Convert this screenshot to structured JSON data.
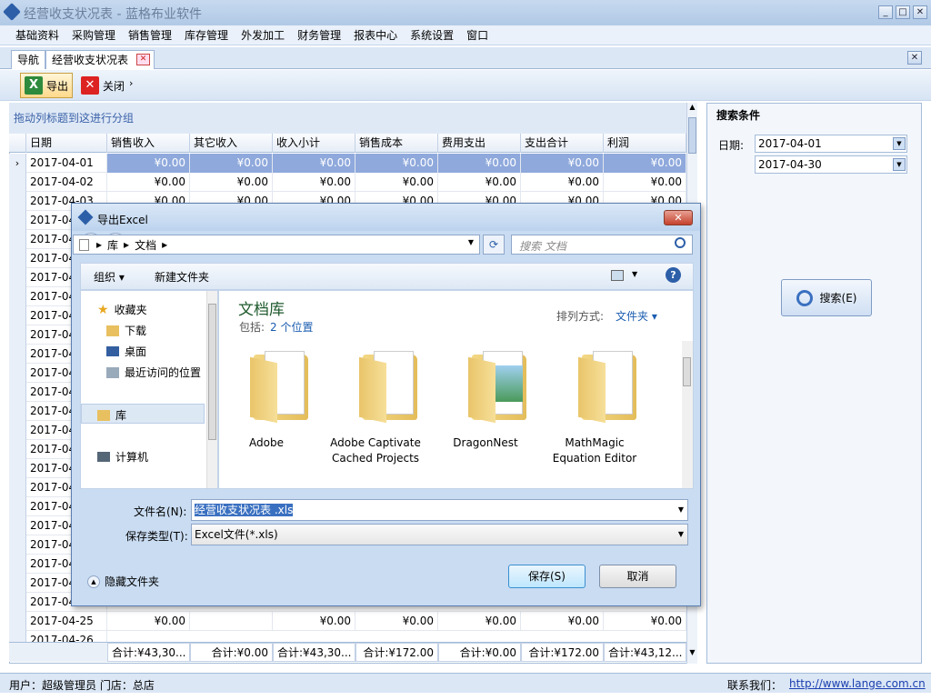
{
  "app": {
    "title": "经营收支状况表 - 蓝格布业软件"
  },
  "menu": [
    "基础资料",
    "采购管理",
    "销售管理",
    "库存管理",
    "外发加工",
    "财务管理",
    "报表中心",
    "系统设置",
    "窗口"
  ],
  "tabs": {
    "nav": "导航",
    "report": "经营收支状况表"
  },
  "toolbar": {
    "export": "导出",
    "close": "关闭"
  },
  "grid": {
    "group_hint": "拖动列标题到这进行分组",
    "columns": [
      "日期",
      "销售收入",
      "其它收入",
      "收入小计",
      "销售成本",
      "费用支出",
      "支出合计",
      "利润"
    ],
    "rows": [
      {
        "date": "2017-04-01",
        "v": [
          "¥0.00",
          "¥0.00",
          "¥0.00",
          "¥0.00",
          "¥0.00",
          "¥0.00",
          "¥0.00"
        ]
      },
      {
        "date": "2017-04-02",
        "v": [
          "¥0.00",
          "¥0.00",
          "¥0.00",
          "¥0.00",
          "¥0.00",
          "¥0.00",
          "¥0.00"
        ]
      },
      {
        "date": "2017-04-03",
        "v": [
          "¥0.00",
          "¥0.00",
          "¥0.00",
          "¥0.00",
          "¥0.00",
          "¥0.00",
          "¥0.00"
        ]
      },
      {
        "date": "2017-04"
      },
      {
        "date": "2017-04"
      },
      {
        "date": "2017-04"
      },
      {
        "date": "2017-04"
      },
      {
        "date": "2017-04"
      },
      {
        "date": "2017-04"
      },
      {
        "date": "2017-04"
      },
      {
        "date": "2017-04"
      },
      {
        "date": "2017-04"
      },
      {
        "date": "2017-04"
      },
      {
        "date": "2017-04"
      },
      {
        "date": "2017-04"
      },
      {
        "date": "2017-04"
      },
      {
        "date": "2017-04"
      },
      {
        "date": "2017-04"
      },
      {
        "date": "2017-04"
      },
      {
        "date": "2017-04"
      },
      {
        "date": "2017-04"
      },
      {
        "date": "2017-04"
      },
      {
        "date": "2017-04"
      },
      {
        "date": "2017-04"
      },
      {
        "date": "2017-04-25",
        "v": [
          "¥0.00",
          "",
          "¥0.00",
          "¥0.00",
          "¥0.00",
          "¥0.00",
          "¥0.00"
        ]
      },
      {
        "date": "2017-04-26"
      }
    ],
    "totals": [
      "合计:¥43,30...",
      "合计:¥0.00",
      "合计:¥43,30...",
      "合计:¥172.00",
      "合计:¥0.00",
      "合计:¥172.00",
      "合计:¥43,12..."
    ]
  },
  "search": {
    "title": "搜索条件",
    "date_label": "日期:",
    "date_from": "2017-04-01",
    "date_to": "2017-04-30",
    "button": "搜索(E)"
  },
  "status": {
    "user": "用户：超级管理员  门店：总店",
    "contact_label": "联系我们：",
    "url": "http://www.lange.com.cn"
  },
  "dialog": {
    "title": "导出Excel",
    "path": [
      "库",
      "文档"
    ],
    "search_placeholder": "搜索 文档",
    "organize": "组织 ▾",
    "new_folder": "新建文件夹",
    "nav": {
      "favorites": "收藏夹",
      "downloads": "下载",
      "desktop": "桌面",
      "recent": "最近访问的位置",
      "library": "库",
      "computer": "计算机"
    },
    "lib_title": "文档库",
    "lib_includes_label": "包括:",
    "lib_includes_link": "2 个位置",
    "sort_label": "排列方式:",
    "sort_value": "文件夹 ▾",
    "folders": [
      {
        "name": "Adobe"
      },
      {
        "name": "Adobe Captivate Cached Projects"
      },
      {
        "name": "DragonNest"
      },
      {
        "name": "MathMagic Equation Editor"
      }
    ],
    "filename_label": "文件名(N):",
    "filename": "经营收支状况表 .xls",
    "filetype_label": "保存类型(T):",
    "filetype": "Excel文件(*.xls)",
    "hide_folders": "隐藏文件夹",
    "save": "保存(S)",
    "cancel": "取消"
  }
}
